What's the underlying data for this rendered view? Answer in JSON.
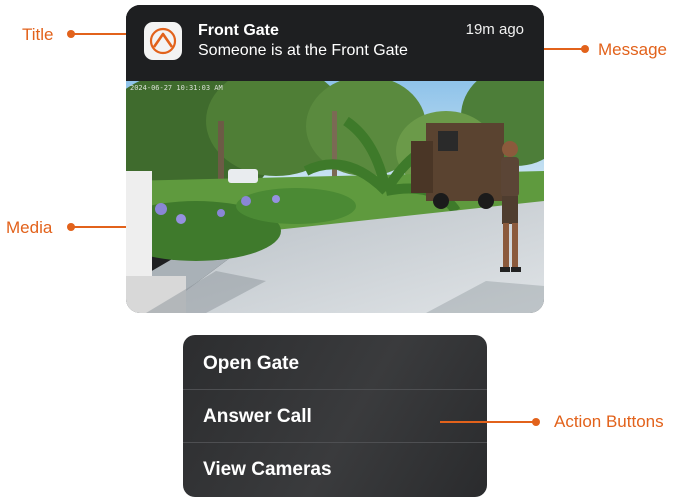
{
  "annotations": {
    "title": "Title",
    "message": "Message",
    "media": "Media",
    "action_buttons": "Action Buttons",
    "color": "#e2621b"
  },
  "notification": {
    "app_icon": "app-logo-icon",
    "title": "Front Gate",
    "time": "19m ago",
    "message": "Someone is at the Front Gate",
    "media_timestamp": "2024-06-27 10:31:03 AM"
  },
  "actions": [
    {
      "label": "Open Gate"
    },
    {
      "label": "Answer Call"
    },
    {
      "label": "View Cameras"
    }
  ]
}
